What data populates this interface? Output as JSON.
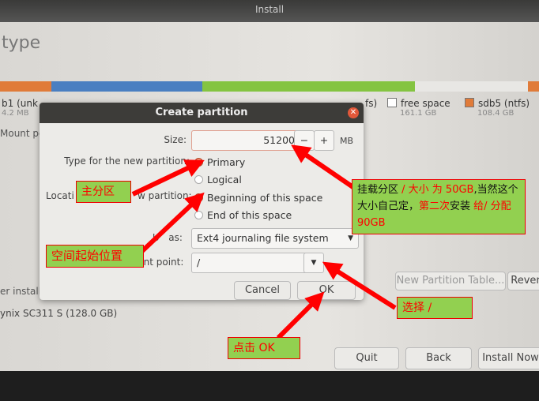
{
  "window": {
    "title": "Install",
    "page_title": "type"
  },
  "partition_bar": {
    "segments": [
      {
        "color": "#e07b39",
        "pct": 9.5
      },
      {
        "color": "#4a7fc1",
        "pct": 28
      },
      {
        "color": "#84c441",
        "pct": 39.5
      },
      {
        "color": "#e8e7e4",
        "pct": 21
      },
      {
        "color": "#e07b39",
        "pct": 2
      }
    ]
  },
  "legend": [
    {
      "name": "b1 (unk",
      "size": "4.2 MB",
      "color": "#e07b39"
    },
    {
      "name": "free space",
      "size": "161.1 GB",
      "color": "#ffffff"
    },
    {
      "name": "sdb5 (ntfs)",
      "size": "108.4 GB",
      "color": "#e07b39"
    }
  ],
  "legend_partial": "fs)",
  "background": {
    "mount_label": "Mount po",
    "installer_label": "er installa",
    "device": "ynix SC311 S (128.0 GB)",
    "new_partition_table": "New Partition Table...",
    "revert": "Rever",
    "quit": "Quit",
    "back": "Back",
    "install_now": "Install Now"
  },
  "dialog": {
    "title": "Create partition",
    "size_label": "Size:",
    "size_value": "51200",
    "size_unit": "MB",
    "minus": "−",
    "plus": "+",
    "type_label": "Type for the new partition:",
    "type_options": [
      {
        "label": "Primary",
        "selected": true
      },
      {
        "label": "Logical",
        "selected": false
      }
    ],
    "location_label": "Locati",
    "location_label_tail": "w partition:",
    "location_options": [
      {
        "label": "Beginning of this space",
        "selected": true
      },
      {
        "label": "End of this space",
        "selected": false
      }
    ],
    "use_as_label": "U",
    "use_as_label_tail": "as:",
    "use_as_value": "Ext4 journaling file system",
    "mount_label": "unt point:",
    "mount_value": "/",
    "cancel": "Cancel",
    "ok": "OK"
  },
  "annotations": {
    "primary": "主分区",
    "start": "空间起始位置",
    "size_note": [
      {
        "t": "挂载分区 ",
        "c": "black"
      },
      {
        "t": "/ 大小 为 50GB",
        "c": "red"
      },
      {
        "t": ",当然这个大小自己定，",
        "c": "black"
      },
      {
        "t": "第二次",
        "c": "red"
      },
      {
        "t": "安装 ",
        "c": "black"
      },
      {
        "t": "给/ 分配 90GB",
        "c": "red"
      }
    ],
    "select": "选择  /",
    "click_ok": "点击 OK"
  },
  "colors": {
    "accent": "#e06030",
    "annotation_bg": "#92d050",
    "annotation_text": "#ff0000",
    "arrow": "#ff0000"
  }
}
